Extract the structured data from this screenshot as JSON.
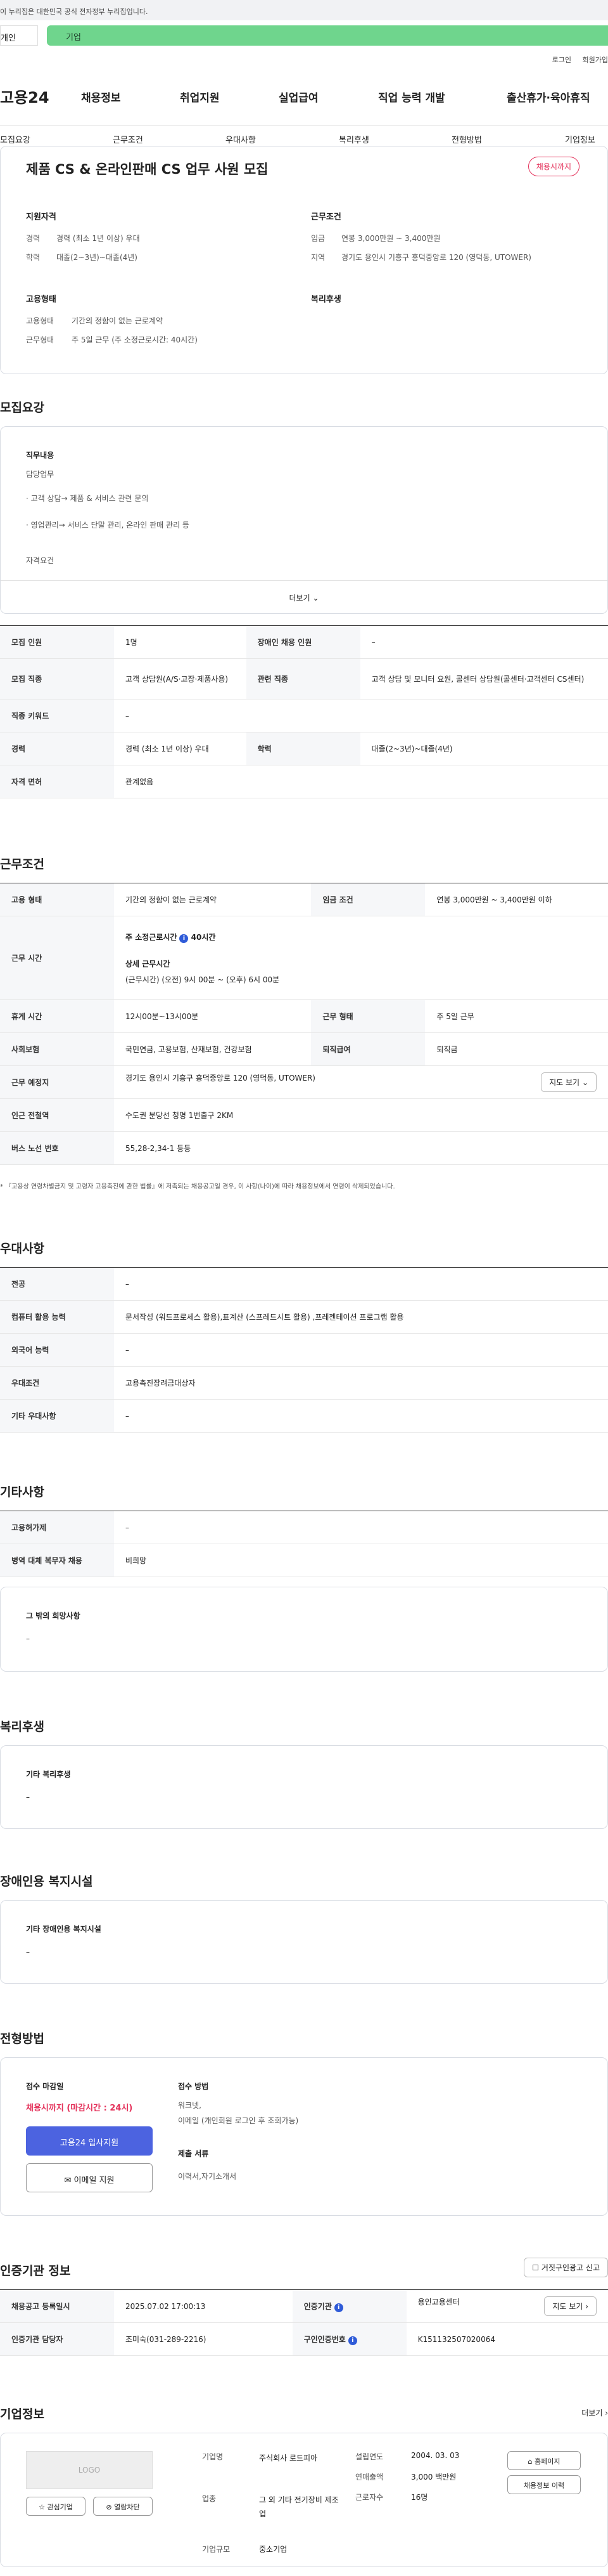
{
  "gov_notice": "이 누리집은 대한민국 공식 전자정부 누리집입니다.",
  "tabs": {
    "individual": "개인",
    "company": "기업"
  },
  "util": {
    "login": "로그인",
    "join": "회원가입"
  },
  "gnb": {
    "logo": "고용24",
    "items": [
      "채용정보",
      "취업지원",
      "실업급여",
      "직업 능력 개발",
      "출산휴가·육아휴직"
    ]
  },
  "subnav": [
    "모집요강",
    "근무조건",
    "우대사항",
    "복리후생",
    "전형방법",
    "기업정보"
  ],
  "job": {
    "title": "제품 CS & 온라인판매 CS 업무 사원 모집",
    "status": "채용시까지",
    "qual_head": "지원자격",
    "cond_head": "근무조건",
    "emp_head": "고용형태",
    "welfare_head": "복리후생",
    "career_label": "경력",
    "career": "경력 (최소 1년 이상) 우대",
    "edu_label": "학력",
    "edu": "대졸(2~3년)~대졸(4년)",
    "wage_label": "임금",
    "wage": "연봉 3,000만원 ~ 3,400만원",
    "region_label": "지역",
    "region": "경기도 용인시 기흥구 흥덕중앙로 120 (영덕동, UTOWER)",
    "emptype_label": "고용형태",
    "emptype": "기간의 정함이 없는 근로계약",
    "worktype_label": "근무형태",
    "worktype": "주 5일 근무 (주 소정근로시간: 40시간)"
  },
  "recruit": {
    "heading": "모집요강",
    "duty_title": "직무내용",
    "duty_sub": "담당업무",
    "duty_1": "· 고객 상담→ 제품 & 서비스 관련 문의",
    "duty_2": "· 영업관리→ 서비스 단말 관리, 온라인 판매 관리 등",
    "duty_3": "자격요건",
    "more": "더보기",
    "rows": [
      [
        "모집 인원",
        "1명",
        "장애인 채용 인원",
        "–"
      ],
      [
        "모집 직종",
        "고객 상담원(A/S·고장·제품사용)",
        "관련 직종",
        "고객 상담 및 모니터 요원, 콜센터 상담원(콜센터·고객센터 CS센터)"
      ],
      [
        "직종 키워드",
        "–"
      ],
      [
        "경력",
        "경력 (최소 1년 이상) 우대",
        "학력",
        "대졸(2~3년)~대졸(4년)"
      ],
      [
        "자격 면허",
        "관계없음"
      ]
    ]
  },
  "conditions": {
    "heading": "근무조건",
    "emptype_label": "고용 형태",
    "emptype": "기간의 정함이 없는 근로계약",
    "wage_label": "임금 조건",
    "wage": "연봉 3,000만원 ~ 3,400만원 이하",
    "hours_label": "근무 시간",
    "hours_week": "주 소정근로시간",
    "hours_week_val": "40시간",
    "hours_detail_title": "상세 근무시간",
    "hours_detail": "(근무시간) (오전) 9시 00분 ~ (오후) 6시 00분",
    "break_label": "휴게 시간",
    "break": "12시00분~13시00분",
    "form_label": "근무 형태",
    "form": "주 5일 근무",
    "ins_label": "사회보험",
    "ins": "국민연금, 고용보험, 산재보험, 건강보험",
    "sev_label": "퇴직급여",
    "sev": "퇴직금",
    "place_label": "근무 예정지",
    "place": "경기도 용인시 기흥구 흥덕중앙로 120 (영덕동, UTOWER)",
    "map_btn": "지도 보기",
    "subway_label": "인근 전철역",
    "subway": "수도권 분당선 청명 1번출구 2KM",
    "bus_label": "버스 노선 번호",
    "bus": "55,28-2,34-1 등등",
    "note": "* 『고용상 연령차별금지 및 고령자 고용촉진에 관한 법률』에 저촉되는 채용공고일 경우, 이 사항(나이)에 따라 채용정보에서 연령이 삭제되었습니다."
  },
  "preference": {
    "heading": "우대사항",
    "rows": [
      [
        "전공",
        "–"
      ],
      [
        "컴퓨터 활용 능력",
        "문서작성 (워드프로세스 활용),표계산 (스프레드시트 활용) ,프레젠테이션 프로그램 활용"
      ],
      [
        "외국어 능력",
        "–"
      ],
      [
        "우대조건",
        "고용촉진장려금대상자"
      ],
      [
        "기타 우대사항",
        "–"
      ]
    ]
  },
  "etc": {
    "heading": "기타사항",
    "rows": [
      [
        "고용허가제",
        "–"
      ],
      [
        "병역 대체 복무자 채용",
        "비희망"
      ]
    ],
    "other_title": "그 밖의 희망사항",
    "other_val": "–"
  },
  "welfare": {
    "heading": "복리후생",
    "title": "기타 복리후생",
    "val": "–"
  },
  "disability": {
    "heading": "장애인용 복지시설",
    "title": "기타 장애인용 복지시설",
    "val": "–"
  },
  "selection": {
    "heading": "전형방법",
    "deadline_title": "접수 마감일",
    "deadline": "채용시까지 (마감시간 : 24시)",
    "apply_btn": "고용24 입사지원",
    "email_btn": "이메일 지원",
    "method_title": "접수 방법",
    "method": "워크넷,",
    "method_2": "이메일 (개인회원 로그인 후 조회가능)",
    "docs_title": "제출 서류",
    "docs": "이력서,자기소개서"
  },
  "certified": {
    "heading": "인증기관 정보",
    "report_btn": "거짓구인광고 신고",
    "reg_label": "채용공고 등록일시",
    "reg": "2025.07.02 17:00:13",
    "agency_label": "인증기관",
    "agency": "용인고용센터",
    "map_btn": "지도 보기",
    "manager_label": "인증기관 담당자",
    "manager": "조미숙(031-289-2216)",
    "cert_label": "구인인증번호",
    "cert": "K151132507020064"
  },
  "company": {
    "heading": "기업정보",
    "more": "더보기",
    "logo": "LOGO",
    "fav_btn": "관심기업",
    "block_btn": "열람차단",
    "name_label": "기업명",
    "name": "주식회사 로드피아",
    "industry_label": "업종",
    "industry": "그 외 기타 전기장비 제조업",
    "size_label": "기업규모",
    "size": "중소기업",
    "founded_label": "설립연도",
    "founded": "2004. 03. 03",
    "revenue_label": "연매출액",
    "revenue": "3,000 백만원",
    "staff_label": "근로자수",
    "staff": "16명",
    "home_btn": "홈페이지",
    "jobs_btn": "채용정보 이력"
  }
}
